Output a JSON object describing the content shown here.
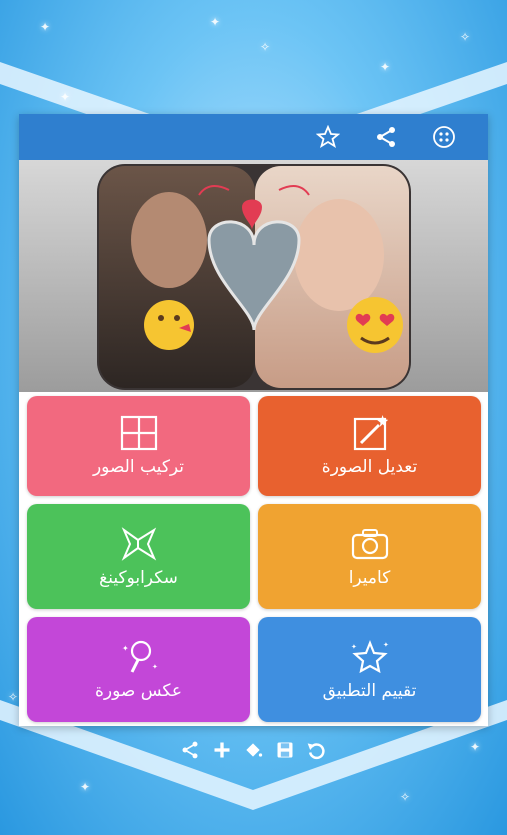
{
  "colors": {
    "toolbar": "#2f7fcf",
    "tile_collage": "#f2697f",
    "tile_edit": "#e8612f",
    "tile_scrapbook": "#4cc25a",
    "tile_camera": "#f0a331",
    "tile_mirror": "#c347d8",
    "tile_rate": "#3f8fe0"
  },
  "toolbar": {
    "icons": [
      "menu-dots-icon",
      "share-icon",
      "star-icon"
    ]
  },
  "banner": {
    "description_icons": [
      "winged-heart",
      "kiss-emoji",
      "heart-eyes-emoji"
    ]
  },
  "tiles": {
    "edit_photo": {
      "label": "تعديل الصورة",
      "icon": "photo-edit-icon"
    },
    "collage": {
      "label": "تركيب الصور",
      "icon": "collage-grid-icon"
    },
    "camera": {
      "label": "كاميرا",
      "icon": "camera-icon"
    },
    "scrapbook": {
      "label": "سكرابوكينغ",
      "icon": "scrapbook-icon"
    },
    "rate_app": {
      "label": "تقييم التطبيق",
      "icon": "star-rate-icon"
    },
    "mirror_photo": {
      "label": "عكس صورة",
      "icon": "magic-mirror-icon"
    }
  },
  "bottom_bar": {
    "icons": [
      "share-icon",
      "plus-icon",
      "paint-bucket-icon",
      "save-icon",
      "undo-icon"
    ]
  }
}
